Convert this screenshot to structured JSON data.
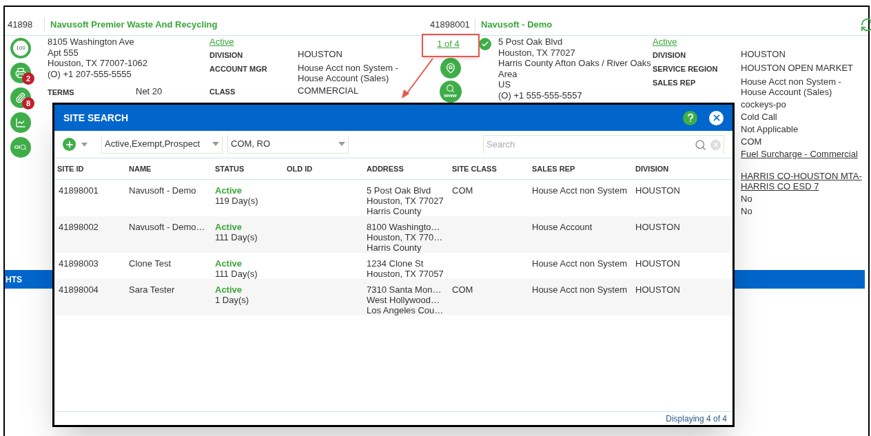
{
  "account": {
    "id": "41898",
    "name": "Navusoft Premier Waste And Recycling"
  },
  "site": {
    "id": "41898001",
    "name": "Navusoft - Demo"
  },
  "account_tools": [
    {
      "kind": "score",
      "label": "100"
    },
    {
      "kind": "printer",
      "badge": "2"
    },
    {
      "kind": "paperclip",
      "badge": "8"
    },
    {
      "kind": "chart"
    },
    {
      "kind": "lookup",
      "label": "OI"
    }
  ],
  "account_details": {
    "address_lines": [
      "8105 Washington Ave",
      "Apt 555",
      "Houston, TX 77007-1062",
      "(O) +1 207-555-5555"
    ],
    "terms": {
      "label": "TERMS",
      "value": "Net 20"
    },
    "status": "Active",
    "fields": [
      {
        "label": "DIVISION",
        "value": "HOUSTON"
      },
      {
        "label": "ACCOUNT MGR",
        "value": "House Acct non System - House Account (Sales)"
      },
      {
        "label": "CLASS",
        "value": "COMMERCIAL"
      }
    ]
  },
  "site_pager": {
    "text": "1 of 4",
    "highlighted": true
  },
  "site_tools": [
    {
      "kind": "map"
    },
    {
      "kind": "web_search",
      "label": "www"
    }
  ],
  "site_details": {
    "verified": true,
    "address_lines": [
      "5 Post Oak Blvd",
      "Houston, TX 77027",
      "Harris County Afton Oaks / River Oaks Area",
      "US",
      "(O) +1 555-555-5557"
    ],
    "status": "Active",
    "fields": [
      {
        "label": "DIVISION",
        "value": "HOUSTON"
      },
      {
        "label": "SERVICE REGION",
        "value": "HOUSTON OPEN MARKET"
      },
      {
        "label": "SALES REP",
        "value": "House Acct non System - House Account (Sales)"
      }
    ],
    "more_values": [
      {
        "kind": "text",
        "text": "cockeys-po"
      },
      {
        "kind": "text",
        "text": "Cold Call"
      },
      {
        "kind": "text",
        "text": "Not Applicable"
      },
      {
        "kind": "text",
        "text": "COM"
      },
      {
        "kind": "link",
        "text": "Fuel Surcharge - Commercial"
      },
      {
        "kind": "link",
        "text": "HARRIS CO-HOUSTON MTA-HARRIS CO ESD 7"
      },
      {
        "kind": "text",
        "text": "No"
      },
      {
        "kind": "text",
        "text": "No"
      }
    ]
  },
  "section_bar": {
    "title": "HTS"
  },
  "dialog": {
    "title": "SITE SEARCH",
    "filters": [
      {
        "value": "Active,Exempt,Prospect"
      },
      {
        "value": "COM, RO"
      }
    ],
    "search": {
      "placeholder": "Search"
    },
    "columns": [
      "SITE ID",
      "NAME",
      "STATUS",
      "OLD ID",
      "ADDRESS",
      "SITE CLASS",
      "SALES REP",
      "DIVISION"
    ],
    "rows": [
      {
        "site_id": "41898001",
        "name": "Navusoft - Demo",
        "status": "Active",
        "age": "119 Day(s)",
        "address": [
          "5 Post Oak Blvd",
          "Houston, TX 77027",
          "Harris County"
        ],
        "site_class": "COM",
        "sales_rep": "House Acct non System",
        "division": "HOUSTON"
      },
      {
        "site_id": "41898002",
        "name": "Navusoft - Demo…",
        "status": "Active",
        "age": "111 Day(s)",
        "address": [
          "8100 Washingto…",
          "Houston, TX 770…",
          "Harris County"
        ],
        "sales_rep": "House Account",
        "division": "HOUSTON"
      },
      {
        "site_id": "41898003",
        "name": "Clone Test",
        "status": "Active",
        "age": "111 Day(s)",
        "address": [
          "1234 Clone St",
          "Houston, TX 77057"
        ],
        "sales_rep": "House Acct non System",
        "division": "HOUSTON"
      },
      {
        "site_id": "41898004",
        "name": "Sara Tester",
        "status": "Active",
        "age": "1 Day(s)",
        "address": [
          "7310 Santa Mon…",
          "West Hollywood…",
          "Los Angeles Cou…"
        ],
        "site_class": "COM",
        "sales_rep": "House Acct non System",
        "division": "HOUSTON"
      }
    ],
    "footer": "Displaying 4 of 4"
  }
}
